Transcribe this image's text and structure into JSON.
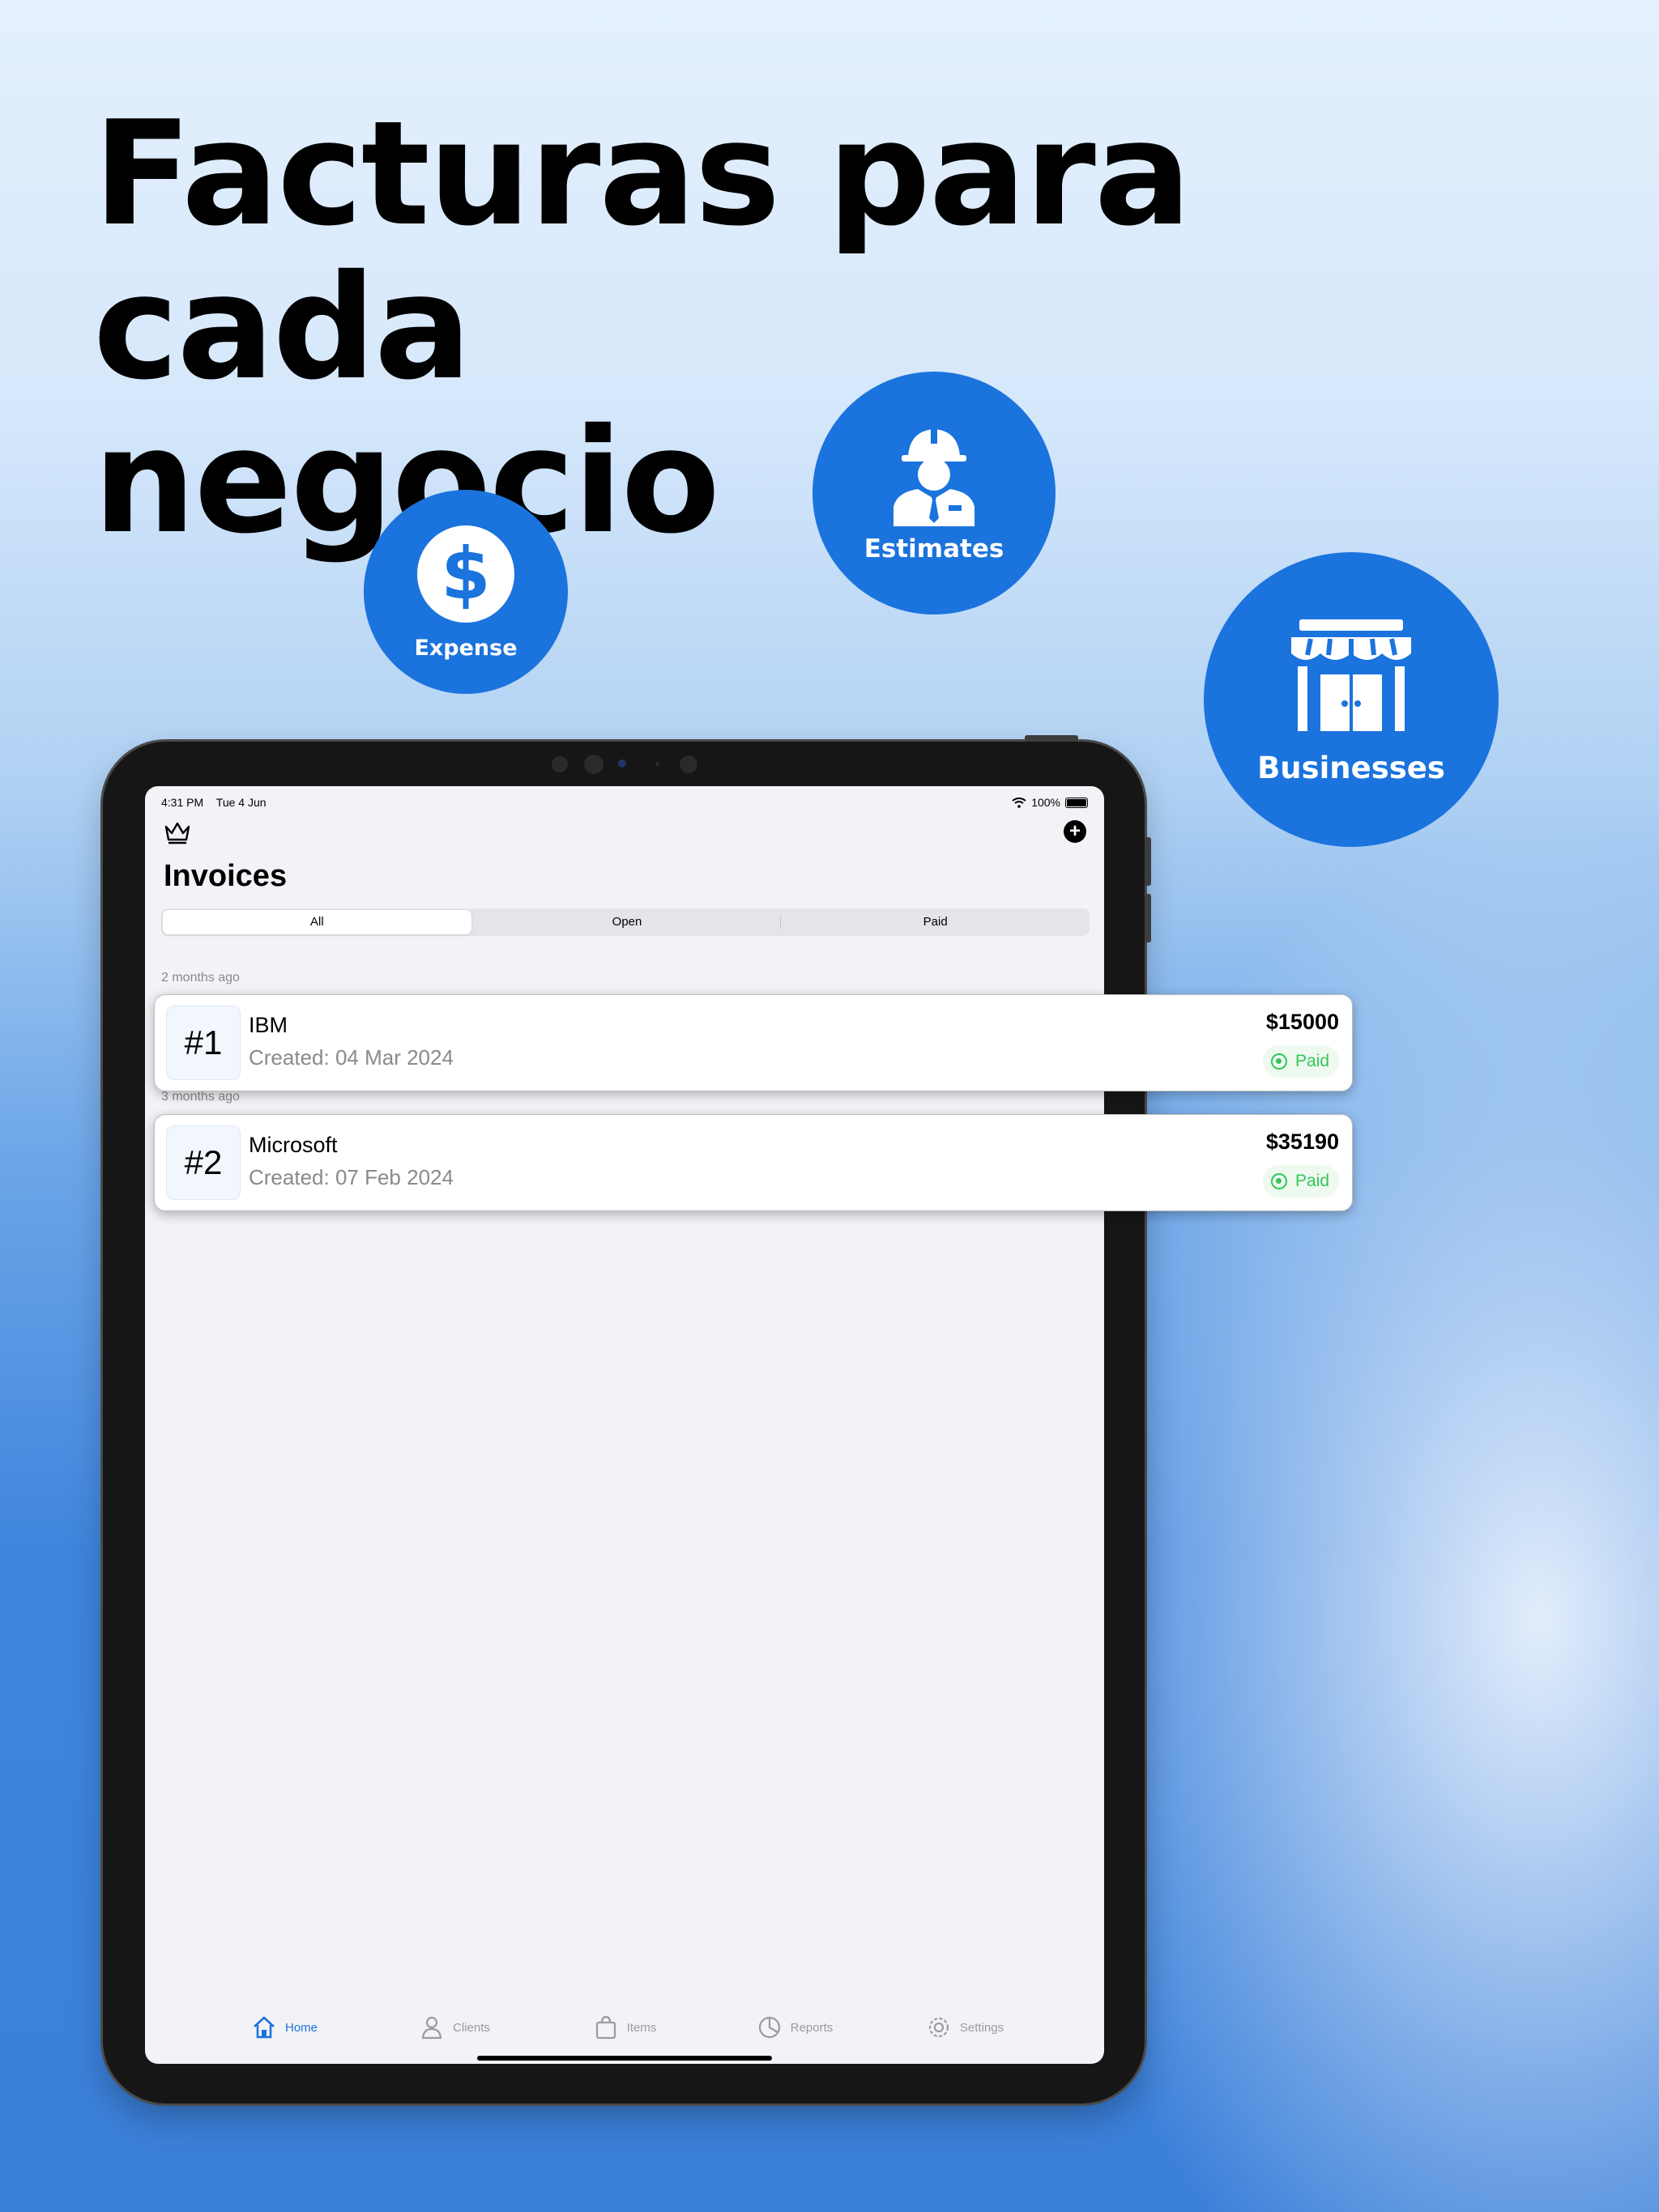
{
  "headline": {
    "line1": "Facturas para cada",
    "line2": "negocio"
  },
  "features": {
    "expense": {
      "label": "Expense",
      "icon": "dollar-icon"
    },
    "estimates": {
      "label": "Estimates",
      "icon": "worker-icon"
    },
    "businesses": {
      "label": "Businesses",
      "icon": "storefront-icon"
    }
  },
  "status_bar": {
    "time": "4:31 PM",
    "date": "Tue 4 Jun",
    "battery": "100%"
  },
  "header": {
    "title": "Invoices"
  },
  "filter": {
    "options": [
      "All",
      "Open",
      "Paid"
    ],
    "selected": "All"
  },
  "sections": [
    {
      "label": "2 months ago"
    },
    {
      "label": "3 months ago"
    }
  ],
  "invoices": [
    {
      "number": "#1",
      "client": "IBM",
      "created": "Created: 04 Mar 2024",
      "amount": "$15000",
      "status": "Paid"
    },
    {
      "number": "#2",
      "client": "Microsoft",
      "created": "Created: 07 Feb 2024",
      "amount": "$35190",
      "status": "Paid"
    }
  ],
  "tabbar": {
    "items": [
      {
        "label": "Home",
        "icon": "home-icon"
      },
      {
        "label": "Clients",
        "icon": "person-icon"
      },
      {
        "label": "Items",
        "icon": "bag-icon"
      },
      {
        "label": "Reports",
        "icon": "pie-chart-icon"
      },
      {
        "label": "Settings",
        "icon": "gear-icon"
      }
    ],
    "active": "Home"
  },
  "colors": {
    "brand": "#1b73dd",
    "paid": "#34c759"
  }
}
